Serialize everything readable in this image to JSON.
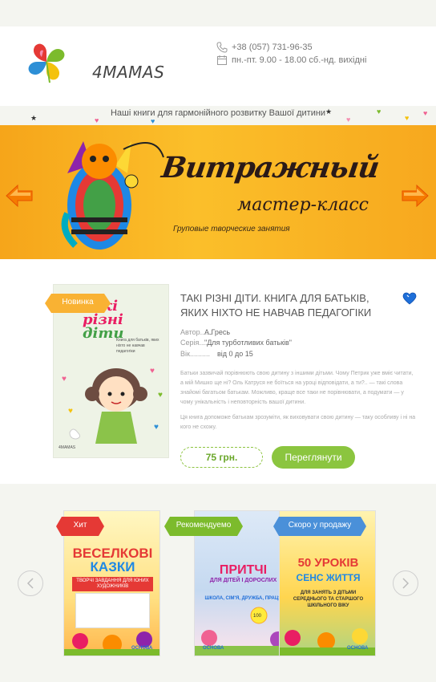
{
  "header": {
    "logo_text": "4MAMAS",
    "phone": "+38 (057) 731-96-35",
    "hours": "пн.-пт. 9.00 - 18.00 сб.-нд. вихідні"
  },
  "tagline": "Наші книги для гармонійного розвитку Вашої дитини",
  "banner": {
    "title": "Витражный",
    "subtitle": "мастер-класс",
    "note": "Груповые творческие занятия"
  },
  "product": {
    "badge": "Новинка",
    "title": "ТАКІ РІЗНІ ДІТИ. КНИГА ДЛЯ БАТЬКІВ, ЯКИХ НІХТО НЕ НАВЧАВ ПЕДАГОГІКИ",
    "author_label": "Автор......",
    "author": "А.Гресь",
    "series_label": "Серія.......",
    "series": "\"Для турботливих батьків\"",
    "age_label": "Вік..........",
    "age": "від 0 до 15",
    "desc1": "Батьки зазвичай порівнюють свою дитину з іншими дітьми. Чому Петрик уже вміє читати, а мій Мишко ще ні? Оль Катруся не боїться на уроці відповідати, а ти?.. — такі слова знайомі багатьом батькам. Можливо, краще все таки не порівнювати, а подумати — у чому унікальність і неповторність вашої дитини.",
    "desc2": "Ця книга допоможе батькам зрозуміти, як виховувати свою дитину — таку особливу і ні на кого не схожу.",
    "price": "75 грн.",
    "view_button": "Переглянути",
    "cover": {
      "title_line1": "Такі",
      "title_line2": "різні",
      "title_line3": "діти",
      "subtitle": "Книга для батьків, яких ніхто не навчав педагогіки",
      "publisher": "4MAMAS"
    }
  },
  "carousel": {
    "cards": [
      {
        "badge": "Хит",
        "badge_color": "#e53935",
        "title_line1": "ВЕСЕЛКОВІ",
        "title_line2": "КАЗКИ",
        "subtitle": "ТВОРЧІ ЗАВДАННЯ ДЛЯ ЮНИХ ХУДОЖНИКІВ",
        "publisher": "ОСНОВА"
      },
      {
        "badge": "Рекомендуемо",
        "badge_color": "#7cbb2c",
        "title_line1": "ПРИТЧІ",
        "title_line2": "ДЛЯ ДІТЕЙ І ДОРОСЛИХ",
        "subtitle": "ШКОЛА, СІМ'Я, ДРУЖБА, ПРАЦЯ",
        "publisher": "ОСНОВА"
      },
      {
        "badge": "Скоро у продажу",
        "badge_color": "#4a90d9",
        "title_line1": "50 УРОКІВ",
        "title_line2": "СЕНС ЖИТТЯ",
        "subtitle": "ДЛЯ ЗАНЯТЬ З ДІТЬМИ СЕРЕДНЬОГО ТА СТАРШОГО ШКІЛЬНОГО ВІКУ",
        "publisher": "ОСНОВА"
      }
    ]
  }
}
